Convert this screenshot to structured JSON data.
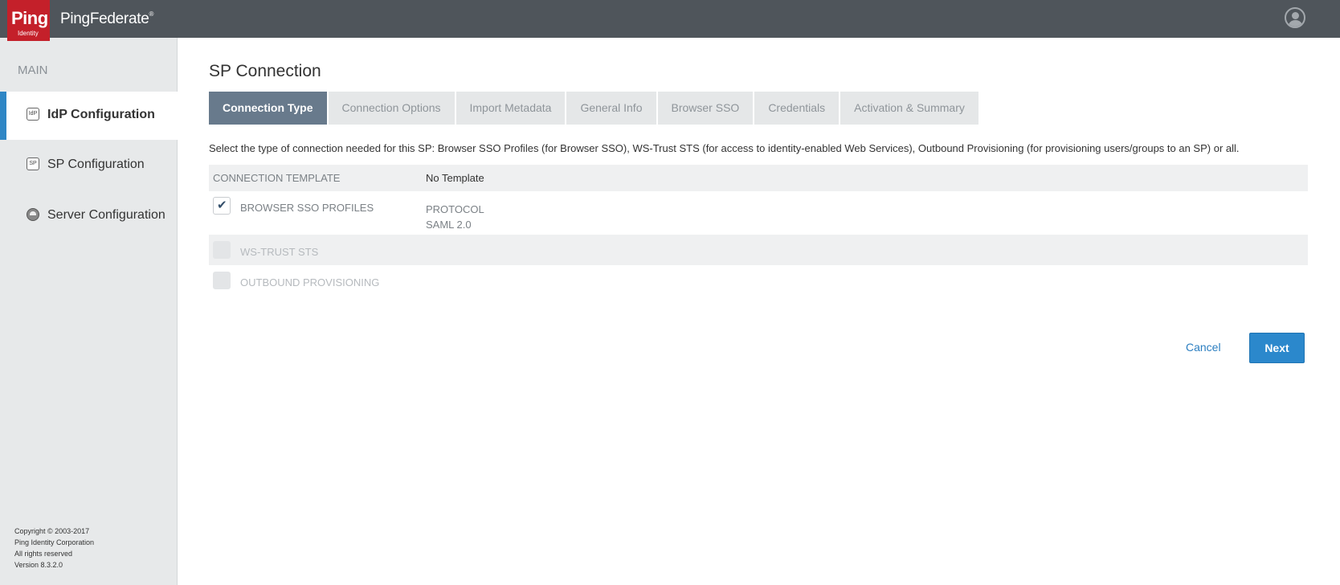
{
  "header": {
    "logo_text": "Ping",
    "logo_subtext": "Identity",
    "product_name": "PingFederate",
    "product_mark": "®"
  },
  "sidebar": {
    "heading": "MAIN",
    "items": [
      {
        "label": "IdP Configuration",
        "icon_text": "IdP",
        "icon": "idp-icon",
        "active": true
      },
      {
        "label": "SP Configuration",
        "icon_text": "SP",
        "icon": "sp-icon",
        "active": false
      },
      {
        "label": "Server Configuration",
        "icon_text": "",
        "icon": "server-icon",
        "active": false
      }
    ],
    "footer": {
      "copyright": "Copyright © 2003-2017",
      "company": "Ping Identity Corporation",
      "rights": "All rights reserved",
      "version": "Version 8.3.2.0"
    }
  },
  "main": {
    "title": "SP Connection",
    "tabs": [
      {
        "label": "Connection Type",
        "active": true
      },
      {
        "label": "Connection Options",
        "active": false
      },
      {
        "label": "Import Metadata",
        "active": false
      },
      {
        "label": "General Info",
        "active": false
      },
      {
        "label": "Browser SSO",
        "active": false
      },
      {
        "label": "Credentials",
        "active": false
      },
      {
        "label": "Activation & Summary",
        "active": false
      }
    ],
    "description": "Select the type of connection needed for this SP: Browser SSO Profiles (for Browser SSO), WS-Trust STS (for access to identity-enabled Web Services), Outbound Provisioning (for provisioning users/groups to an SP) or all.",
    "template_row": {
      "label": "CONNECTION TEMPLATE",
      "value": "No Template"
    },
    "options": [
      {
        "label": "BROWSER SSO PROFILES",
        "checked": true,
        "enabled": true,
        "protocol_label": "PROTOCOL",
        "protocol_value": "SAML 2.0"
      },
      {
        "label": "WS-TRUST STS",
        "checked": false,
        "enabled": false
      },
      {
        "label": "OUTBOUND PROVISIONING",
        "checked": false,
        "enabled": false
      }
    ],
    "actions": {
      "cancel": "Cancel",
      "next": "Next"
    }
  },
  "colors": {
    "header_bg": "#4f555b",
    "brand_red": "#c4202a",
    "accent_blue": "#2b88cc",
    "active_tab": "#687a8c",
    "sidebar_bg": "#e7e9ea"
  }
}
